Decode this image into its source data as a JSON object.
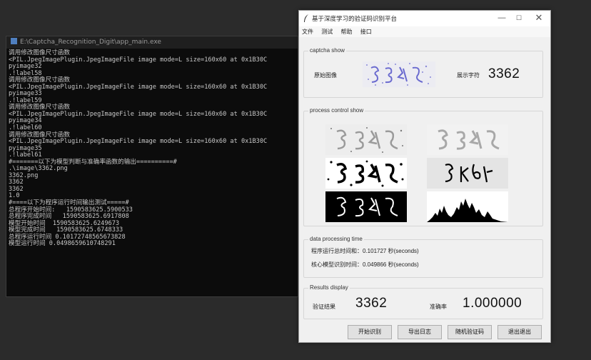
{
  "console": {
    "title": "E:\\Captcha_Recognition_Digit\\app_main.exe",
    "lines": [
      "调用修改图像尺寸函数",
      "<PIL.JpegImagePlugin.JpegImageFile image mode=L size=160x60 at 0x1B30C",
      "pyimage32",
      ".!label58",
      "调用修改图像尺寸函数",
      "<PIL.JpegImagePlugin.JpegImageFile image mode=L size=160x60 at 0x1B30C",
      "pyimage33",
      ".!label59",
      "调用修改图像尺寸函数",
      "<PIL.JpegImagePlugin.JpegImageFile image mode=L size=160x60 at 0x1B30C",
      "pyimage34",
      ".!label60",
      "调用修改图像尺寸函数",
      "<PIL.JpegImagePlugin.JpegImageFile image mode=L size=160x60 at 0x1B30C",
      "pyimage35",
      ".!label61",
      "#=======以下为模型判断与准确率函数的输出==========#",
      ".\\image\\3362.png",
      "3362.png",
      "3362",
      "3362",
      "1.0",
      "#====以下为程序运行时间输出测试=====#",
      "总程序开始时间:   1590583625.5900533",
      "总程序完成时间   1590583625.6917808",
      "模型开始时间  1590583625.6249673",
      "模型完成时间   1590583625.6748333",
      "总程序运行时间 0.10172748565673828",
      "模型运行时间 0.0498659610748291"
    ]
  },
  "app": {
    "title": "基于深度学习的验证码识别平台",
    "menu": [
      "文件",
      "测试",
      "帮助",
      "接口"
    ],
    "captcha_show": {
      "title": "captcha show",
      "original_label": "原始图像",
      "display_label": "展示字符",
      "display_value": "3362"
    },
    "process": {
      "title": "process control show"
    },
    "timing": {
      "title": "data processing time",
      "total_line": "程序运行总时间和：0.101727 秒(seconds)",
      "core_line": "核心模型识别时间：0.049866 秒(seconds)"
    },
    "results": {
      "title": "Results display",
      "result_label": "验证结果",
      "result_value": "3362",
      "accuracy_label": "准确率",
      "accuracy_value": "1.000000"
    },
    "buttons": {
      "start": "开始识别",
      "export": "导出日志",
      "random": "随机验证码",
      "exit": "退出退出"
    }
  },
  "colors": {
    "console_bg": "#0c0c0c",
    "window_bg": "#f0f0f0",
    "captcha_ink": "#6a6acf"
  },
  "icons": [
    "feather-icon",
    "minimize-icon",
    "maximize-icon",
    "close-icon",
    "console-app-icon"
  ]
}
